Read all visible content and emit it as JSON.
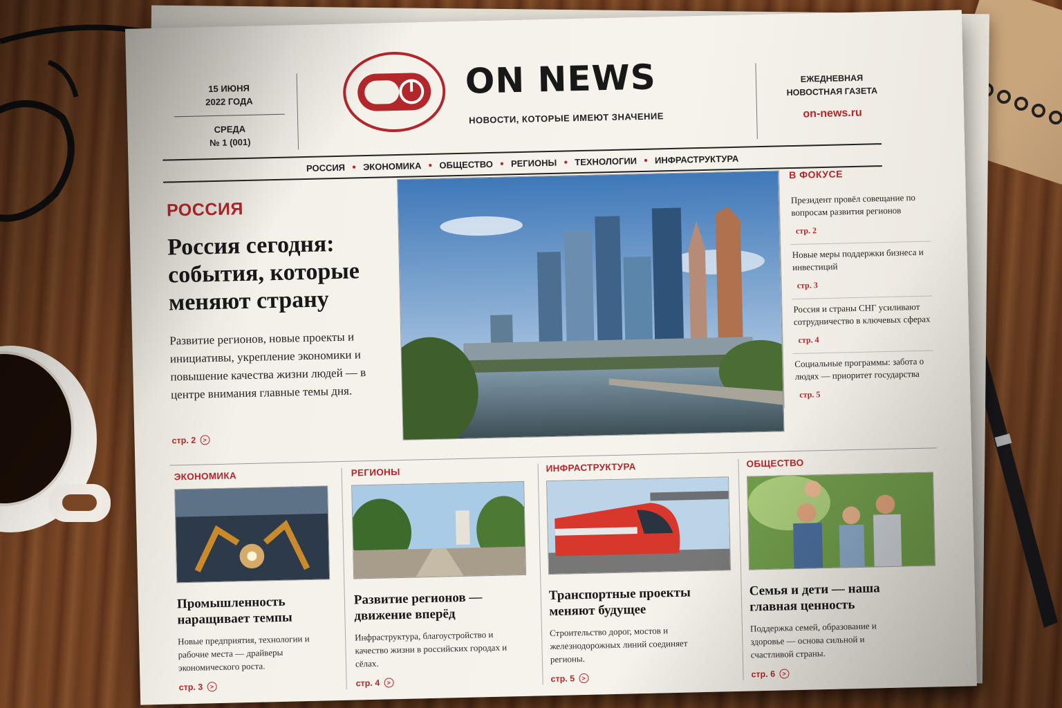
{
  "masthead": {
    "date_line1": "15 ИЮНЯ",
    "date_line2": "2022 ГОДА",
    "weekday": "СРЕДА",
    "issue": "№ 1 (001)",
    "brand": "ON NEWS",
    "tagline": "НОВОСТИ, КОТОРЫЕ ИМЕЮТ ЗНАЧЕНИЕ",
    "right_line1": "ЕЖЕДНЕВНАЯ",
    "right_line2": "НОВОСТНАЯ ГАЗЕТА",
    "site": "on-news.ru",
    "logo_icon": "power-toggle-icon",
    "accent": "#b3262a"
  },
  "nav": [
    "РОССИЯ",
    "ЭКОНОМИКА",
    "ОБЩЕСТВО",
    "РЕГИОНЫ",
    "ТЕХНОЛОГИИ",
    "ИНФРАСТРУКТУРА"
  ],
  "lead": {
    "kicker": "РОССИЯ",
    "title": "Россия сегодня: события, которые меняют страну",
    "text": "Развитие регионов, новые проекты и инициативы, укрепление экономики и повышение качества жизни людей — в центре внимания главные темы дня.",
    "page": "стр. 2"
  },
  "focus": {
    "title": "В ФОКУСЕ",
    "items": [
      {
        "text": "Президент провёл совещание по вопросам развития регионов",
        "page": "стр. 2"
      },
      {
        "text": "Новые меры поддержки бизнеса и инвестиций",
        "page": "стр. 3"
      },
      {
        "text": "Россия и страны СНГ усиливают сотрудничество в ключевых сферах",
        "page": "стр. 4"
      },
      {
        "text": "Социальные программы: забота о людях — приоритет государства",
        "page": "стр. 5"
      }
    ]
  },
  "columns": [
    {
      "kicker": "ЭКОНОМИКА",
      "title": "Промышленность наращивает темпы",
      "text": "Новые предприятия, технологии и рабочие места — драйверы экономического роста.",
      "page": "стр. 3"
    },
    {
      "kicker": "РЕГИОНЫ",
      "title": "Развитие регионов — движение вперёд",
      "text": "Инфраструктура, благоустройство и качество жизни в российских городах и сёлах.",
      "page": "стр. 4"
    },
    {
      "kicker": "ИНФРАСТРУКТУРА",
      "title": "Транспортные проекты меняют будущее",
      "text": "Строительство дорог, мостов и железнодорожных линий соединяет регионы.",
      "page": "стр. 5"
    },
    {
      "kicker": "ОБЩЕСТВО",
      "title": "Семья и дети — наша главная ценность",
      "text": "Поддержка семей, образование и здоровье — основа сильной и счастливой страны.",
      "page": "стр. 6"
    }
  ]
}
